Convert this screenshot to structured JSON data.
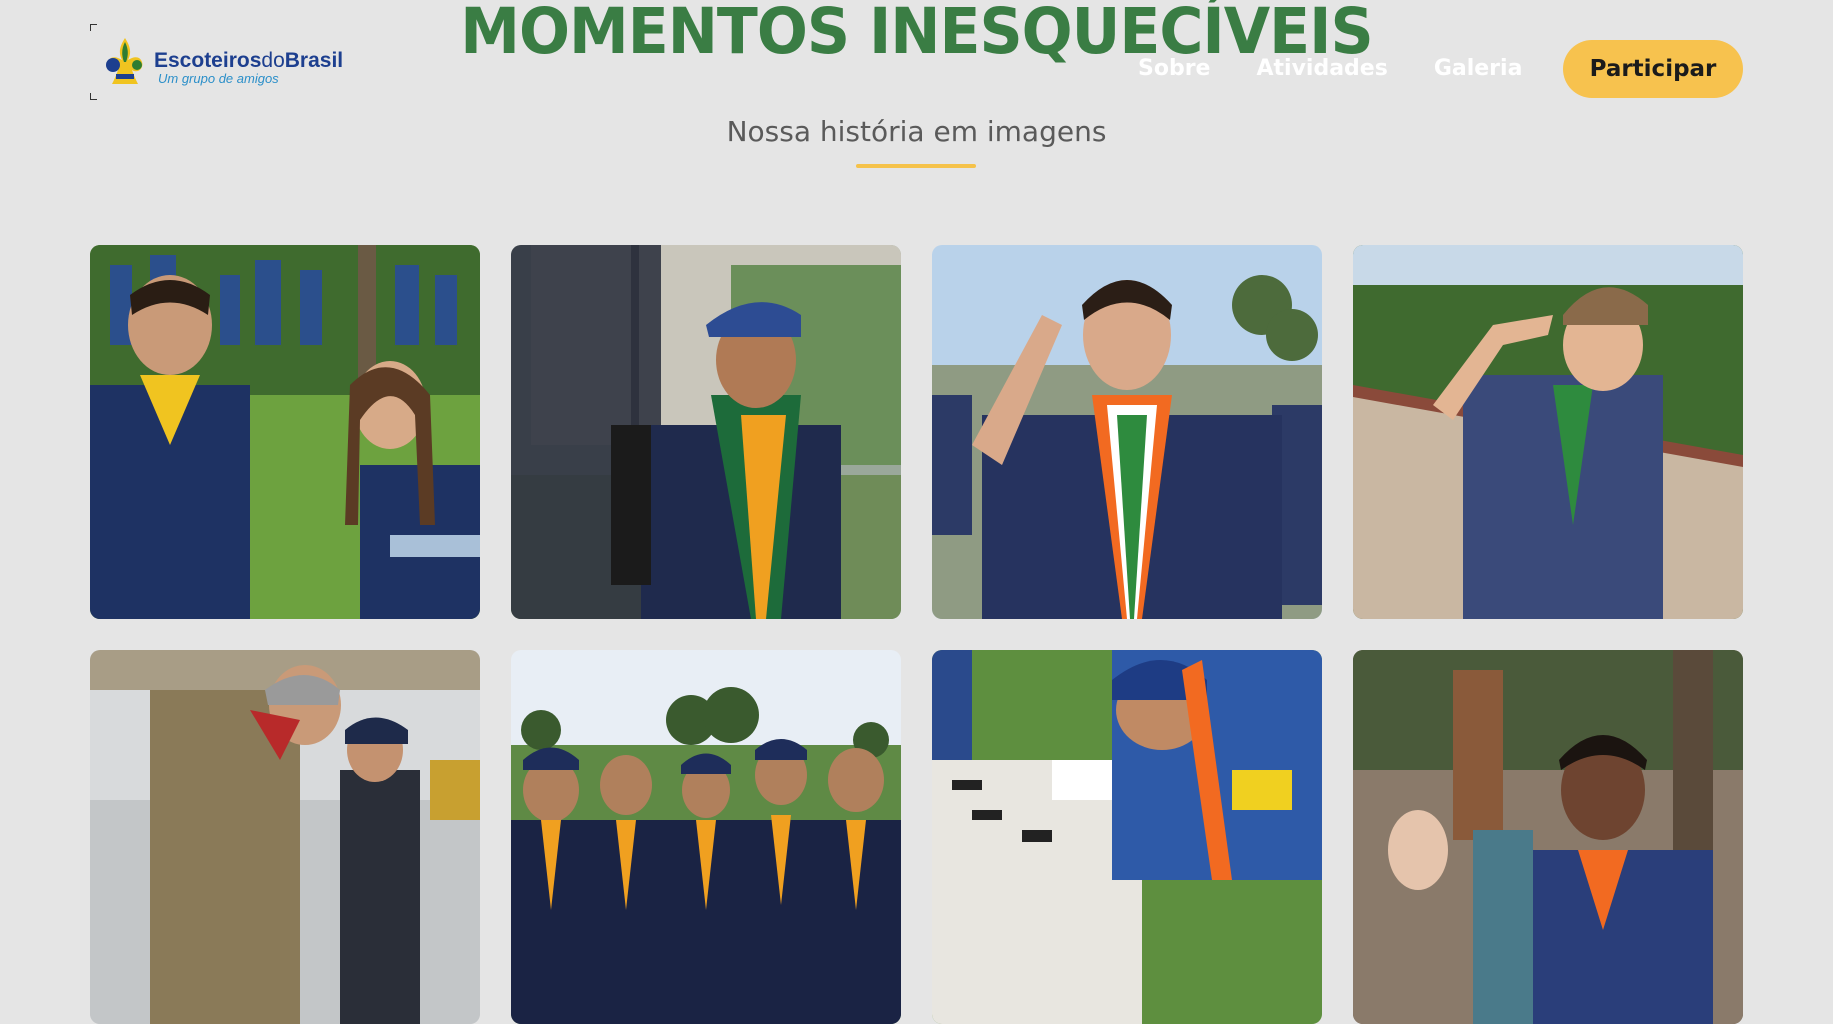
{
  "header": {
    "logo": {
      "name_part1": "Escoteiros",
      "name_part2": "do",
      "name_part3": "Brasil",
      "tagline": "Um grupo de amigos"
    },
    "nav": [
      {
        "label": "Sobre"
      },
      {
        "label": "Atividades"
      },
      {
        "label": "Galeria"
      }
    ],
    "cta_label": "Participar"
  },
  "section": {
    "title": "MOMENTOS INESQUECÍVEIS",
    "subtitle": "Nossa história em imagens"
  },
  "colors": {
    "background": "#e5e5e5",
    "title_green": "#3a7d44",
    "accent_yellow": "#f7c24e",
    "logo_blue": "#1d3f8f"
  },
  "gallery": {
    "photos": [
      {
        "scene": "Two young scouts laughing outdoors"
      },
      {
        "scene": "Smiling scout with cap and backpack"
      },
      {
        "scene": "Scout saluting at camp"
      },
      {
        "scene": "Young scout saluting by a wall"
      },
      {
        "scene": "Leader tying scarf for young scout"
      },
      {
        "scene": "Group of young scouts posing"
      },
      {
        "scene": "Scouts working at a table"
      },
      {
        "scene": "Smiling boy in scout uniform"
      }
    ]
  }
}
